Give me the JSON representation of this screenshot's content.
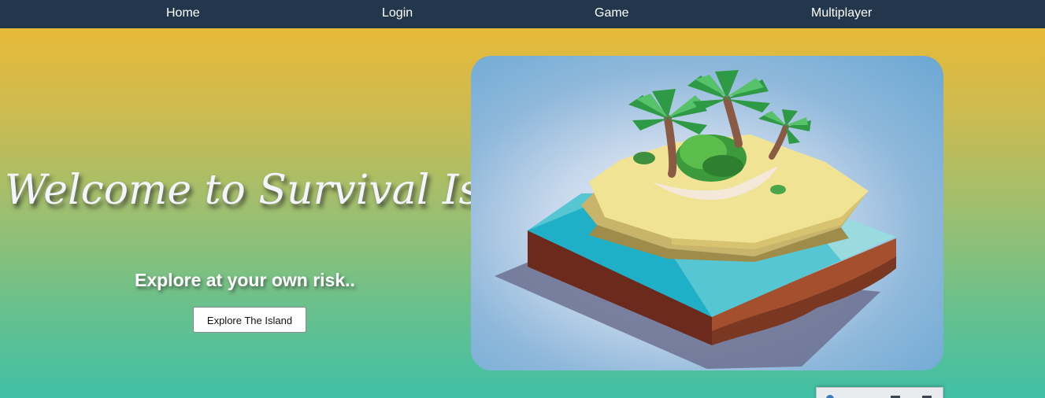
{
  "nav": {
    "items": [
      {
        "label": "Home"
      },
      {
        "label": "Login"
      },
      {
        "label": "Game"
      },
      {
        "label": "Multiplayer"
      }
    ]
  },
  "hero": {
    "title": "Welcome to Survival Island",
    "subtitle": "Explore at your own risk..",
    "button_label": "Explore The Island"
  },
  "image": {
    "description_icon": "island-illustration"
  },
  "colors": {
    "navbar": "#22374b",
    "gradient_top": "#f0b930",
    "gradient_bottom": "#40c0a6",
    "card_bg": "#6aa7d3"
  }
}
